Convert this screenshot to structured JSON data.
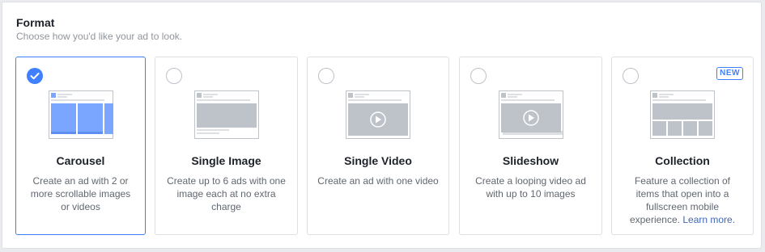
{
  "section": {
    "title": "Format",
    "subtitle": "Choose how you'd like your ad to look."
  },
  "colors": {
    "accent": "#4080ff",
    "selected_fill": "#7aa6ff",
    "placeholder_gray": "#bec2c9"
  },
  "cards": [
    {
      "title": "Carousel",
      "description": "Create an ad with 2 or more scrollable images or videos",
      "selected": true,
      "icon": "carousel-icon"
    },
    {
      "title": "Single Image",
      "description": "Create up to 6 ads with one image each at no extra charge",
      "selected": false,
      "icon": "single-image-icon"
    },
    {
      "title": "Single Video",
      "description": "Create an ad with one video",
      "selected": false,
      "icon": "single-video-icon"
    },
    {
      "title": "Slideshow",
      "description": "Create a looping video ad with up to 10 images",
      "selected": false,
      "icon": "slideshow-icon"
    },
    {
      "title": "Collection",
      "description": "Feature a collection of items that open into a fullscreen mobile experience.",
      "link": "Learn more.",
      "badge": "NEW",
      "selected": false,
      "icon": "collection-icon"
    }
  ]
}
